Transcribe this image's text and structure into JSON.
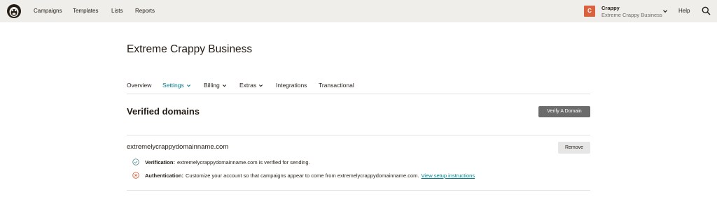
{
  "topnav": {
    "items": [
      "Campaigns",
      "Templates",
      "Lists",
      "Reports"
    ],
    "help_label": "Help"
  },
  "account": {
    "initial": "C",
    "name": "Crappy",
    "org": "Extreme Crappy Business",
    "avatar_color": "#d8623f"
  },
  "page": {
    "title": "Extreme Crappy Business"
  },
  "tabs": [
    {
      "label": "Overview"
    },
    {
      "label": "Settings",
      "active": true
    },
    {
      "label": "Billing"
    },
    {
      "label": "Extras"
    },
    {
      "label": "Integrations"
    },
    {
      "label": "Transactional"
    }
  ],
  "verified": {
    "title": "Verified domains",
    "verify_button": "Verify A Domain",
    "domain": "extremelycrappydomainname.com",
    "remove_button": "Remove",
    "verification_label": "Verification:",
    "verification_text": "extremelycrappydomainname.com is verified for sending.",
    "authentication_label": "Authentication:",
    "authentication_text": "Customize your account so that campaigns appear to come from extremelycrappydomainname.com.",
    "authentication_link": "View setup instructions"
  },
  "colors": {
    "accent": "#007c89",
    "topbar": "#efeeea",
    "success": "#5a8f9a",
    "error": "#d8623f"
  },
  "icons": [
    "mailchimp-logo-icon",
    "chevron-down-icon",
    "search-icon",
    "check-circle-icon",
    "error-circle-icon"
  ]
}
